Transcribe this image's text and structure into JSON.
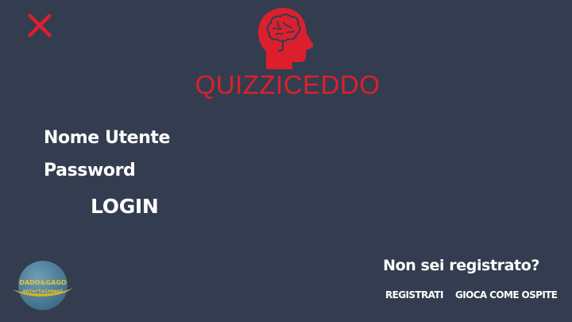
{
  "header": {
    "close_icon": "close-icon",
    "logo_icon": "brain-head-icon",
    "app_name": "QUIZZICEDDO"
  },
  "form": {
    "username_label": "Nome Utente",
    "password_label": "Password",
    "login_label": "LOGIN"
  },
  "footer": {
    "badge_line1": "DADO&GAGO",
    "badge_line2": "entertainment",
    "register_prompt": "Non sei registrato?",
    "register_label": "REGISTRATI",
    "guest_label": "GIOCA COME OSPITE"
  },
  "colors": {
    "background": "#333d4f",
    "accent": "#dd1f2d",
    "text": "#ffffff"
  }
}
